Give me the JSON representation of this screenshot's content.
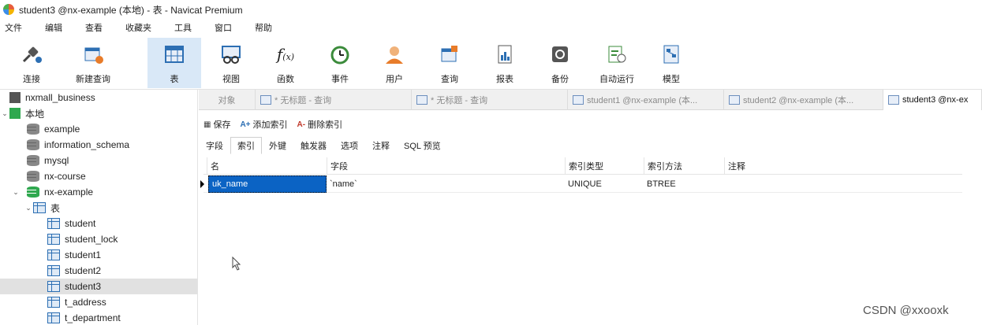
{
  "window": {
    "title": "student3 @nx-example (本地) - 表 - Navicat Premium"
  },
  "menu": [
    "文件",
    "编辑",
    "查看",
    "收藏夹",
    "工具",
    "窗口",
    "帮助"
  ],
  "toolbar": [
    {
      "label": "连接",
      "icon": "plug-icon"
    },
    {
      "label": "新建查询",
      "icon": "new-query-icon"
    },
    {
      "label": "表",
      "icon": "table-icon",
      "active": true
    },
    {
      "label": "视图",
      "icon": "view-icon"
    },
    {
      "label": "函数",
      "icon": "function-icon"
    },
    {
      "label": "事件",
      "icon": "clock-icon"
    },
    {
      "label": "用户",
      "icon": "user-icon"
    },
    {
      "label": "查询",
      "icon": "query-icon"
    },
    {
      "label": "报表",
      "icon": "report-icon"
    },
    {
      "label": "备份",
      "icon": "backup-icon"
    },
    {
      "label": "自动运行",
      "icon": "schedule-icon"
    },
    {
      "label": "模型",
      "icon": "model-icon"
    }
  ],
  "sidebar": {
    "nodes": [
      {
        "label": "nxmall_business",
        "type": "connection"
      },
      {
        "label": "本地",
        "type": "connection-open"
      },
      {
        "label": "example",
        "type": "db"
      },
      {
        "label": "information_schema",
        "type": "db"
      },
      {
        "label": "mysql",
        "type": "db"
      },
      {
        "label": "nx-course",
        "type": "db"
      },
      {
        "label": "nx-example",
        "type": "db-open"
      },
      {
        "label": "表",
        "type": "folder"
      },
      {
        "label": "student",
        "type": "table"
      },
      {
        "label": "student_lock",
        "type": "table"
      },
      {
        "label": "student1",
        "type": "table"
      },
      {
        "label": "student2",
        "type": "table"
      },
      {
        "label": "student3",
        "type": "table",
        "selected": true
      },
      {
        "label": "t_address",
        "type": "table"
      },
      {
        "label": "t_department",
        "type": "table"
      }
    ]
  },
  "tabs": [
    {
      "label": "对象"
    },
    {
      "label": "* 无标题 - 查询"
    },
    {
      "label": "* 无标题 - 查询"
    },
    {
      "label": "student1 @nx-example (本..."
    },
    {
      "label": "student2 @nx-example (本..."
    },
    {
      "label": "student3 @nx-ex",
      "active": true
    }
  ],
  "actions": {
    "save": "保存",
    "add_index": "添加索引",
    "delete_index": "删除索引"
  },
  "subtabs": [
    "字段",
    "索引",
    "外键",
    "触发器",
    "选项",
    "注释",
    "SQL 预览"
  ],
  "active_subtab": "索引",
  "grid": {
    "columns": [
      "名",
      "字段",
      "索引类型",
      "索引方法",
      "注释"
    ],
    "rows": [
      [
        "uk_name",
        "`name`",
        "UNIQUE",
        "BTREE",
        ""
      ]
    ]
  },
  "watermark": "CSDN @xxooxk",
  "colors": {
    "selection": "#0b63c4",
    "active_toolbar": "#d9e8f7",
    "db_open": "#2fa84f"
  }
}
